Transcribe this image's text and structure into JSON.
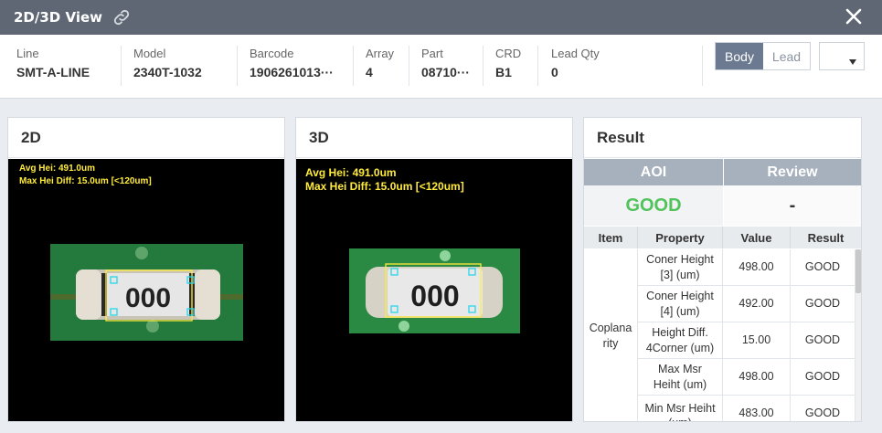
{
  "title": "2D/3D View",
  "info": {
    "line": {
      "label": "Line",
      "value": "SMT-A-LINE"
    },
    "model": {
      "label": "Model",
      "value": "2340T-1032"
    },
    "barcode": {
      "label": "Barcode",
      "value": "1906261013···"
    },
    "array": {
      "label": "Array",
      "value": "4"
    },
    "part": {
      "label": "Part",
      "value": "08710···"
    },
    "crd": {
      "label": "CRD",
      "value": "B1"
    },
    "lead_qty": {
      "label": "Lead Qty",
      "value": "0"
    }
  },
  "view_toggle": {
    "body": "Body",
    "lead": "Lead",
    "selected": "Body"
  },
  "panel_2d": {
    "title": "2D",
    "avg_hei": "Avg Hei: 491.0um",
    "max_hei_diff": "Max Hei Diff:   15.0um [<120um]",
    "component_marking": "000"
  },
  "panel_3d": {
    "title": "3D",
    "avg_hei": "Avg Hei: 491.0um",
    "max_hei_diff": "Max Hei Diff: 15.0um [<120um]",
    "component_marking": "000"
  },
  "result": {
    "title": "Result",
    "aoi_label": "AOI",
    "review_label": "Review",
    "aoi_value": "GOOD",
    "review_value": "-",
    "columns": [
      "Item",
      "Property",
      "Value",
      "Result"
    ],
    "item_group": "Coplanarity",
    "rows": [
      {
        "property": "Coner Height [3] (um)",
        "value": "498.00",
        "result": "GOOD"
      },
      {
        "property": "Coner Height [4] (um)",
        "value": "492.00",
        "result": "GOOD"
      },
      {
        "property": "Height Diff. 4Corner (um)",
        "value": "15.00",
        "result": "GOOD"
      },
      {
        "property": "Max Msr Heiht (um)",
        "value": "498.00",
        "result": "GOOD"
      },
      {
        "property": "Min Msr Heiht (um)",
        "value": "483.00",
        "result": "GOOD"
      }
    ]
  },
  "colors": {
    "titlebar": "#5f6775",
    "good": "#52c25a",
    "overlay_text": "#ffeb3b",
    "active_toggle": "#6b7a90"
  },
  "icons": {
    "link": "link-icon",
    "close": "close-icon",
    "dropdown": "chevron-down-icon"
  }
}
